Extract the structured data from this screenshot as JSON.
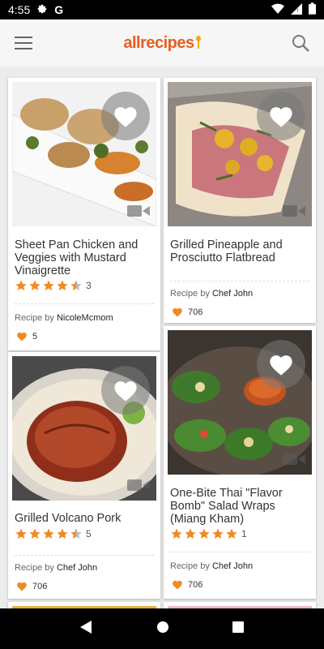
{
  "status_bar": {
    "time": "4:55",
    "g_label": "G"
  },
  "app": {
    "logo": "allrecipes"
  },
  "cards": [
    {
      "title": "Sheet Pan Chicken and Veggies with Mustard Vinaigrette",
      "stars": 4.5,
      "rating_count": "3",
      "author_prefix": "Recipe by",
      "author": "NicoleMcmom",
      "likes": "5"
    },
    {
      "title": "Grilled Pineapple and Prosciutto Flatbread",
      "stars": 0,
      "rating_count": "",
      "author_prefix": "Recipe by",
      "author": "Chef John",
      "likes": "706"
    },
    {
      "title": "Grilled Volcano Pork",
      "stars": 4.5,
      "rating_count": "5",
      "author_prefix": "Recipe by",
      "author": "Chef John",
      "likes": "706"
    },
    {
      "title": "One-Bite Thai \"Flavor Bomb\" Salad Wraps (Miang Kham)",
      "stars": 5,
      "rating_count": "1",
      "author_prefix": "Recipe by",
      "author": "Chef John",
      "likes": "706"
    }
  ],
  "colors": {
    "accent": "#e65f1f",
    "star": "#f08a24",
    "heart": "#f08a24"
  }
}
